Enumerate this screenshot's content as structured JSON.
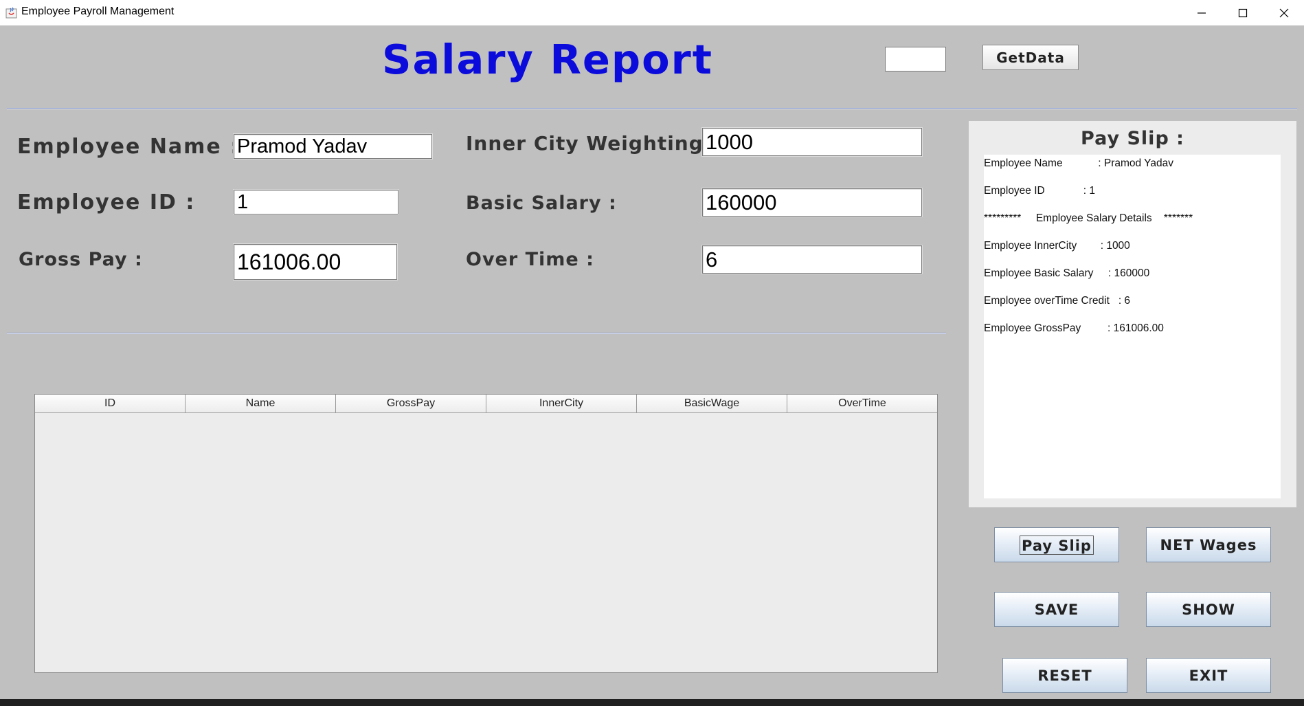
{
  "window": {
    "title": "Employee Payroll Management"
  },
  "header": {
    "title": "Salary Report",
    "search_value": "",
    "getdata_label": "GetData"
  },
  "form": {
    "employee_name_label": "Employee Name :",
    "employee_name_value": "Pramod Yadav",
    "employee_id_label": "Employee ID :",
    "employee_id_value": "1",
    "gross_pay_label": "Gross Pay :",
    "gross_pay_value": "161006.00",
    "inner_city_label": "Inner City Weighting :",
    "inner_city_value": "1000",
    "basic_salary_label": "Basic Salary :",
    "basic_salary_value": "160000",
    "over_time_label": "Over Time :",
    "over_time_value": "6"
  },
  "table": {
    "columns": [
      "ID",
      "Name",
      "GrossPay",
      "InnerCity",
      "BasicWage",
      "OverTime"
    ],
    "rows": []
  },
  "pay_slip": {
    "title": "Pay Slip :",
    "lines": [
      "Employee Name            : Pramod Yadav",
      "Employee ID             : 1",
      "*********     Employee Salary Details    *******",
      "Employee InnerCity        : 1000",
      "Employee Basic Salary     : 160000",
      "Employee overTime Credit   : 6",
      "Employee GrossPay         : 161006.00"
    ]
  },
  "buttons": {
    "pay_slip": "Pay Slip",
    "net_wages": "NET Wages",
    "save": "SAVE",
    "show": "SHOW",
    "reset": "RESET",
    "exit": "EXIT"
  },
  "colors": {
    "title_blue": "#0b0bdc",
    "background": "#c0c0c0",
    "separator": "#8a99c9"
  }
}
